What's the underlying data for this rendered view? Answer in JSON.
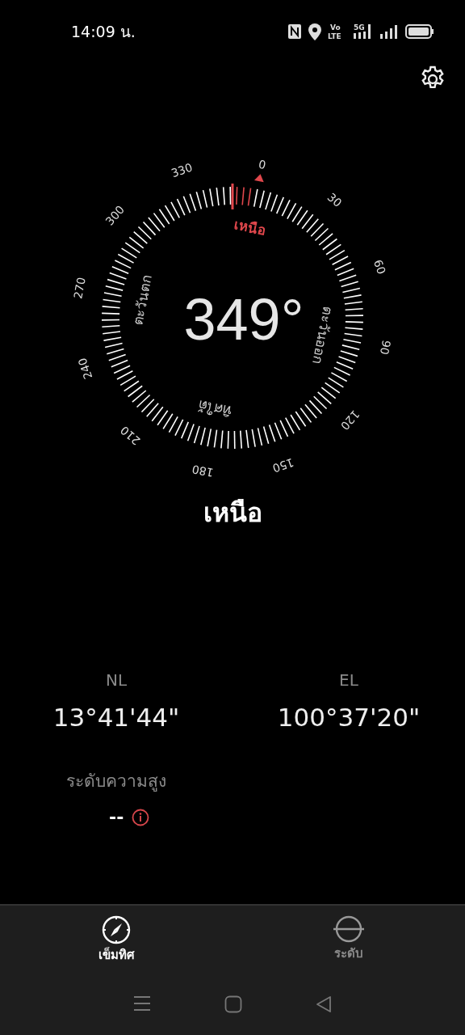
{
  "status_bar": {
    "time": "14:09 น.",
    "volte_label": [
      "Vo",
      "LTE"
    ],
    "network_type": "5G"
  },
  "compass": {
    "heading": "349°",
    "degree_labels": [
      "0",
      "30",
      "60",
      "90",
      "120",
      "150",
      "180",
      "210",
      "240",
      "270",
      "300",
      "330"
    ],
    "cardinal_labels": [
      {
        "label": "เหนือ",
        "selected": true
      },
      {
        "label": "ตะวันออก",
        "selected": false
      },
      {
        "label": "ทิศใต้",
        "selected": false
      },
      {
        "label": "ตะวันตก",
        "selected": false
      }
    ]
  },
  "direction": "เหนือ",
  "coordinates": [
    {
      "label": "NL",
      "value": "13°41'44\""
    },
    {
      "label": "EL",
      "value": "100°37'20\""
    }
  ],
  "altitude": {
    "label": "ระดับความสูง",
    "value": "--"
  },
  "tabs": [
    {
      "label": "เข็มทิศ",
      "kind": "compass",
      "selected": true
    },
    {
      "label": "ระดับ",
      "kind": "level",
      "selected": false
    }
  ]
}
